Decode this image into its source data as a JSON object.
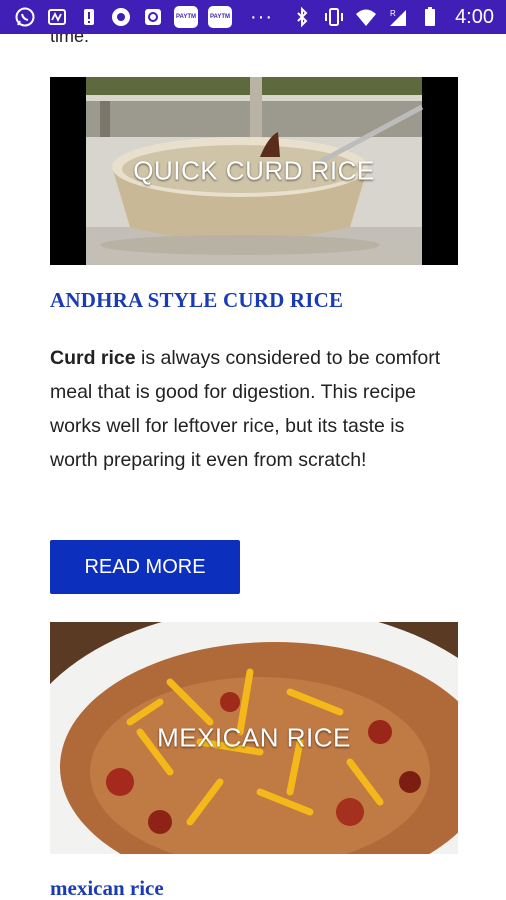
{
  "status_bar": {
    "badge1": "PAYTM",
    "badge2": "PAYTM",
    "more": "···",
    "time": "4:00",
    "signal_mark": "R"
  },
  "article_partial": {
    "text": "time."
  },
  "posts": [
    {
      "thumb_overlay": "QUICK CURD RICE",
      "title": "ANDHRA STYLE CURD RICE",
      "desc_bold": "Curd rice",
      "desc_rest": " is always considered to be comfort meal that is good for digestion. This recipe works well for leftover rice, but its taste is worth preparing it even from scratch!",
      "button": "READ MORE"
    },
    {
      "thumb_overlay": "MEXICAN RICE",
      "title": "mexican rice"
    }
  ],
  "colors": {
    "status_bar": "#3f1fb6",
    "title": "#1a3bb3",
    "button": "#0c2fbd"
  }
}
